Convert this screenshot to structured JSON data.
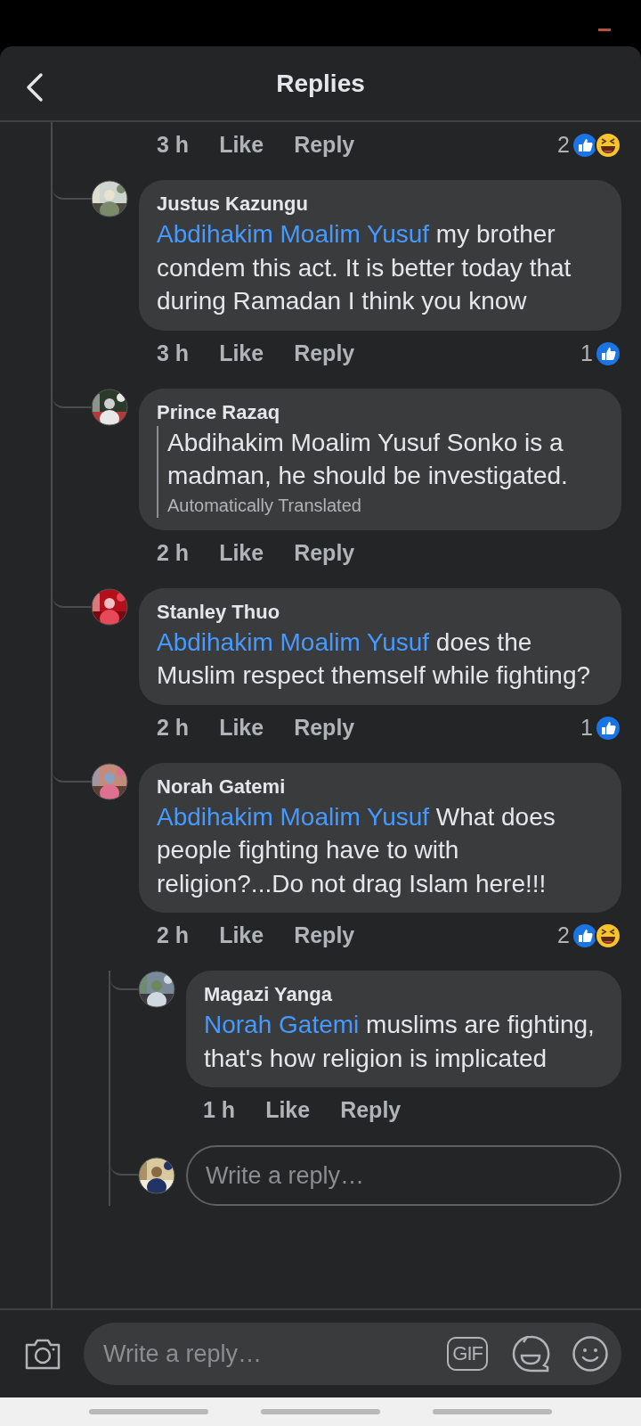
{
  "header": {
    "title": "Replies"
  },
  "previous_actions": {
    "time": "3 h",
    "like": "Like",
    "reply": "Reply",
    "reaction_count": "2",
    "reactions": [
      {
        "kind": "like"
      },
      {
        "kind": "haha"
      }
    ]
  },
  "comments": [
    {
      "author": "Justus Kazungu",
      "mention": "Abdihakim Moalim Yusuf",
      "text": "my brother condem this act. It is better today that during Ramadan I think you know",
      "time": "3 h",
      "like": "Like",
      "reply": "Reply",
      "reaction_count": "1",
      "reactions": [
        {
          "kind": "like"
        }
      ]
    },
    {
      "author": "Prince Razaq",
      "text": "Abdihakim Moalim Yusuf Sonko is a madman, he should be investigated.",
      "translation_note": "Automatically Translated",
      "time": "2 h",
      "like": "Like",
      "reply": "Reply"
    },
    {
      "author": "Stanley Thuo",
      "mention": "Abdihakim Moalim Yusuf",
      "text": "does the Muslim respect themself while fighting?",
      "time": "2 h",
      "like": "Like",
      "reply": "Reply",
      "reaction_count": "1",
      "reactions": [
        {
          "kind": "like"
        }
      ]
    },
    {
      "author": "Norah Gatemi",
      "mention": "Abdihakim Moalim Yusuf",
      "text": "What does people fighting have to with religion?...Do not drag Islam here!!!",
      "time": "2 h",
      "like": "Like",
      "reply": "Reply",
      "reaction_count": "2",
      "reactions": [
        {
          "kind": "like"
        },
        {
          "kind": "haha"
        }
      ],
      "children": [
        {
          "author": "Magazi Yanga",
          "mention": "Norah Gatemi",
          "text": "muslims are fighting, that's how religion is implicated",
          "time": "1 h",
          "like": "Like",
          "reply": "Reply"
        }
      ],
      "reply_field": {
        "placeholder": "Write a reply…"
      }
    }
  ],
  "composer": {
    "placeholder": "Write a reply…",
    "gif_label": "GIF"
  }
}
